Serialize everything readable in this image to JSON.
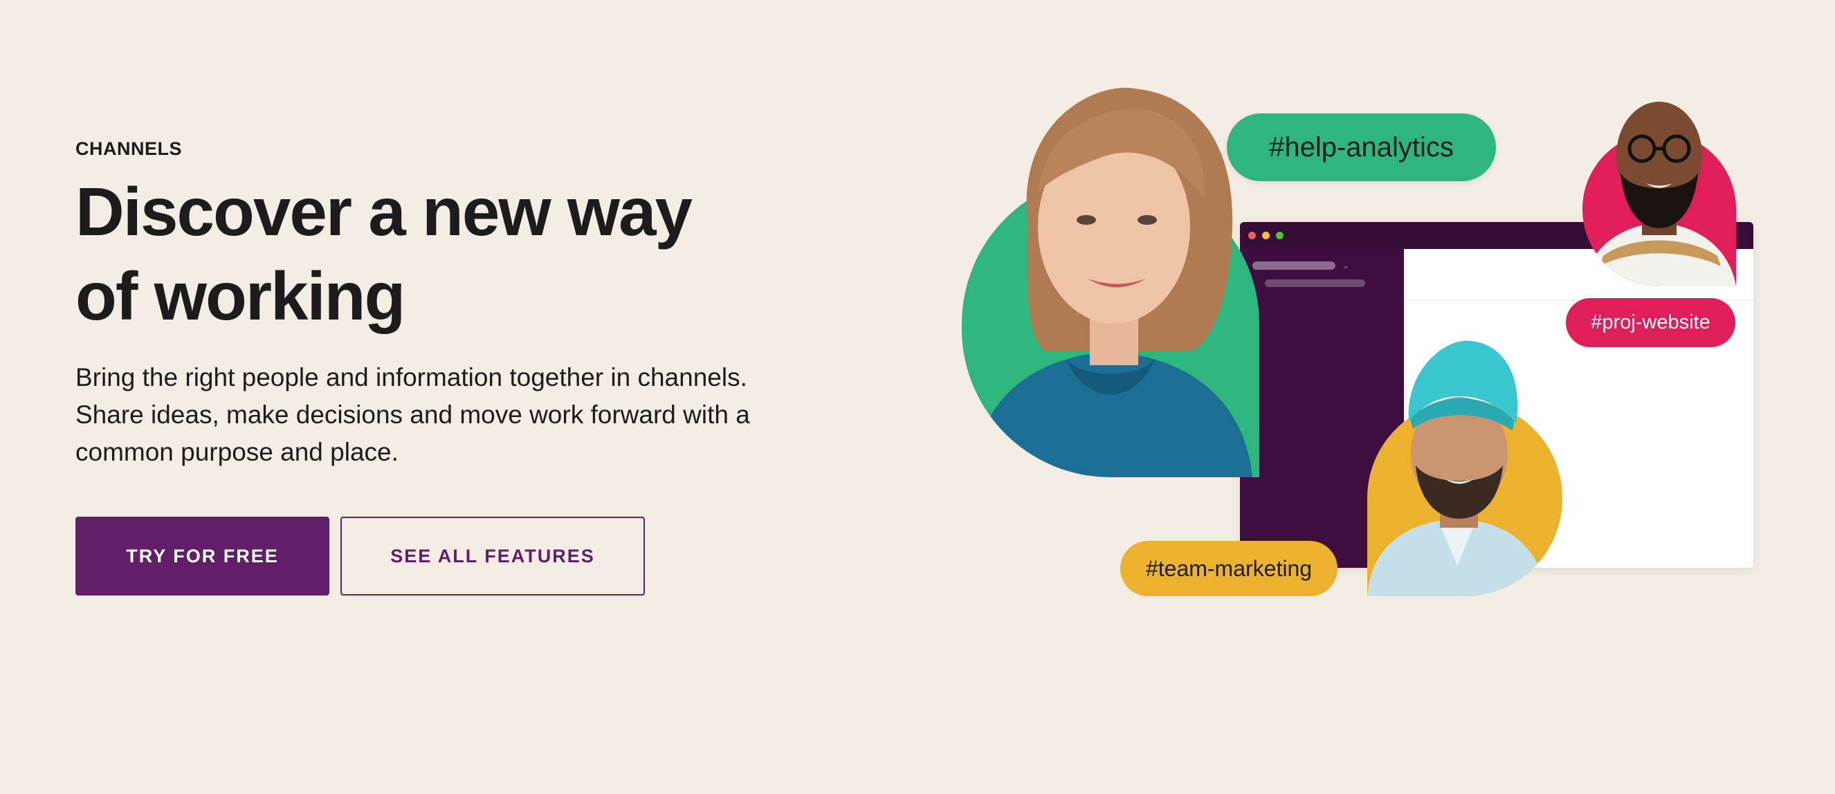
{
  "hero": {
    "eyebrow": "CHANNELS",
    "headline": "Discover a new way of working",
    "subcopy": "Bring the right people and information together in channels. Share ideas, make decisions and move work forward with a common purpose and place."
  },
  "ctas": {
    "primary_label": "TRY FOR FREE",
    "secondary_label": "SEE ALL FEATURES"
  },
  "illustration": {
    "channel_tags": [
      {
        "label": "#help-analytics",
        "color": "#2eb67d"
      },
      {
        "label": "#proj-website",
        "color": "#e01e5a"
      },
      {
        "label": "#team-marketing",
        "color": "#ecb22e"
      }
    ]
  },
  "colors": {
    "background": "#f4ede4",
    "brand_purple": "#611f69",
    "green": "#2eb67d",
    "red": "#e01e5a",
    "yellow": "#ecb22e",
    "sidebar": "#3f0e40"
  }
}
